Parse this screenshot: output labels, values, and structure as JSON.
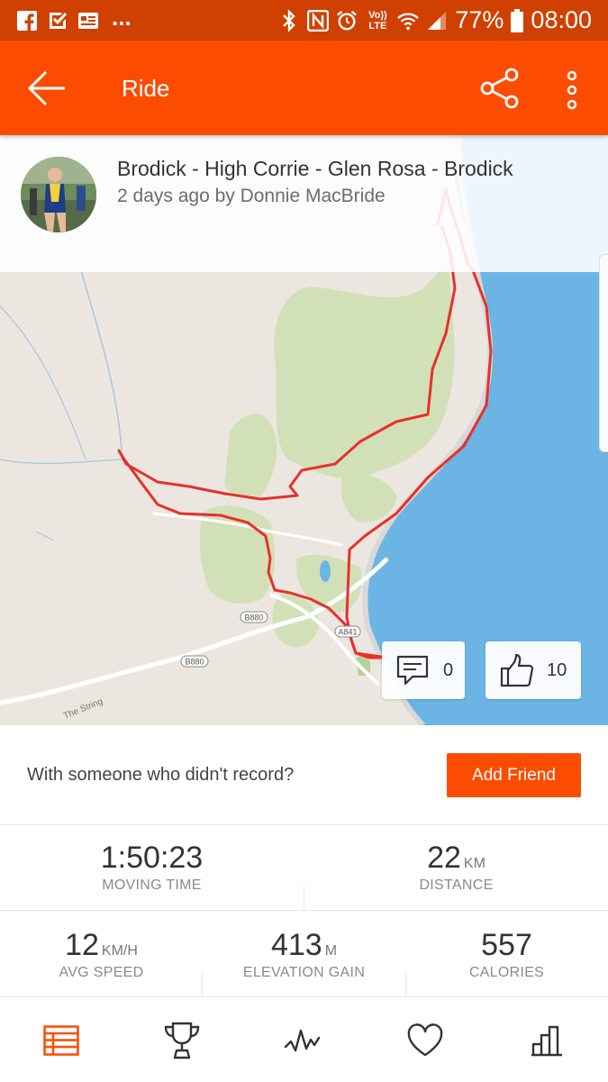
{
  "status_bar": {
    "battery": "77%",
    "time": "08:00",
    "volte": "Vo)) LTE",
    "icons": [
      "facebook-icon",
      "checkbox-icon",
      "news-icon",
      "more-notifications-icon",
      "bluetooth-icon",
      "nfc-icon",
      "alarm-icon",
      "volte-icon",
      "wifi-icon",
      "signal-icon",
      "battery-icon"
    ],
    "more": "..."
  },
  "app_bar": {
    "title": "Ride",
    "icons": [
      "back-arrow-icon",
      "share-icon",
      "more-vert-icon"
    ]
  },
  "activity": {
    "title": "Brodick - High Corrie - Glen Rosa - Brodick",
    "subtitle": "2 days ago by Donnie MacBride"
  },
  "map": {
    "road_labels": [
      "B880",
      "B880",
      "A841",
      "The String"
    ],
    "comments_count": "0",
    "kudos_count": "10",
    "route_color": "#e8302a",
    "sea_color": "#6cb4e4"
  },
  "friend_prompt": {
    "text": "With someone who didn't record?",
    "button": "Add Friend"
  },
  "stats": [
    {
      "value": "1:50:23",
      "unit": "",
      "label": "MOVING TIME"
    },
    {
      "value": "22",
      "unit": "KM",
      "label": "DISTANCE"
    },
    {
      "value": "12",
      "unit": "KM/H",
      "label": "AVG SPEED"
    },
    {
      "value": "413",
      "unit": "M",
      "label": "ELEVATION GAIN"
    },
    {
      "value": "557",
      "unit": "",
      "label": "CALORIES"
    }
  ],
  "bottom_nav": [
    "overview-icon",
    "trophy-icon",
    "analysis-icon",
    "heart-icon",
    "stats-icon"
  ],
  "colors": {
    "accent": "#fc4c02",
    "status_bar": "#d04000"
  }
}
